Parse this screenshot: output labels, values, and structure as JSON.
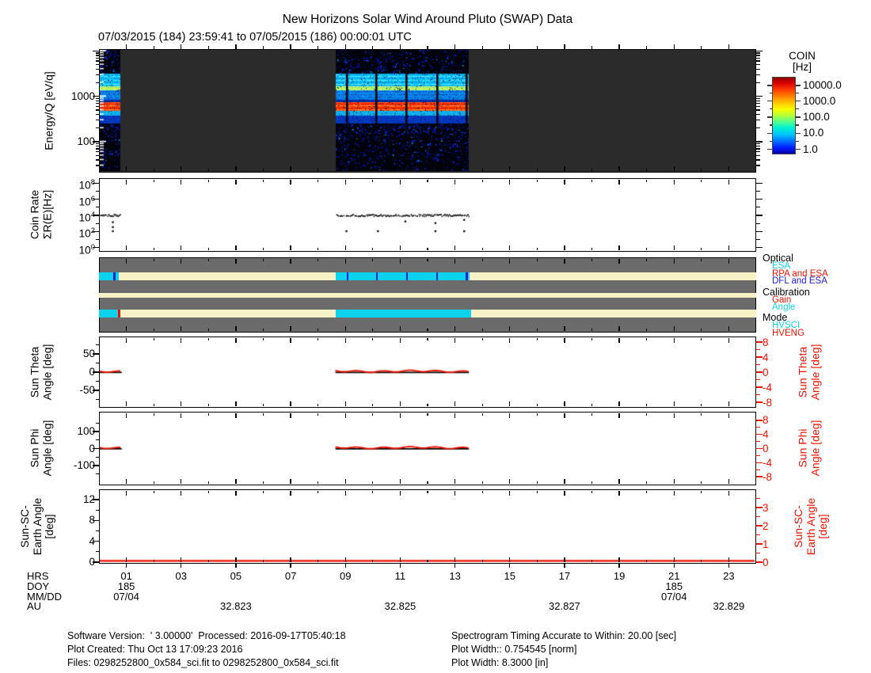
{
  "title": "New Horizons Solar Wind Around Pluto (SWAP) Data",
  "subtitle": "07/03/2015 (184) 23:59:41 to 07/05/2015 (186) 00:00:01 UTC",
  "colors": {
    "cyan": "#0CD2EE",
    "red": "#EE1100",
    "blue": "#2121D6",
    "cream": "#F6F2C6",
    "panel_gray": "#6B6B6B",
    "spec_bg": "#2B2B2B",
    "black": "#000000",
    "white": "#FFFFFF"
  },
  "colorbar": {
    "title_lines": [
      "COIN",
      "[Hz]"
    ],
    "tick_labels": [
      "10000.0",
      "1000.0",
      "100.0",
      "10.0",
      "1.0"
    ]
  },
  "panels": {
    "spectrogram": {
      "ylabel_lines": [
        "Energy/Q [eV/q]"
      ],
      "ytick_labels": [
        "1000",
        "100"
      ]
    },
    "coinrate": {
      "ylabel_lines": [
        "Coin Rate",
        "ΣR(E)[Hz]"
      ],
      "ytick_exponents": [
        "8",
        "6",
        "4",
        "2",
        "0"
      ]
    },
    "theta": {
      "ylabel_lines": [
        "Sun Theta",
        "Angle [deg]"
      ],
      "left_tick_labels": [
        "50",
        "0",
        "-50"
      ],
      "right_label_lines": [
        "Sun Theta",
        "Angle [deg]"
      ],
      "right_tick_labels": [
        "8",
        "4",
        "0",
        "-4",
        "-8"
      ]
    },
    "phi": {
      "ylabel_lines": [
        "Sun Phi",
        "Angle [deg]"
      ],
      "left_tick_labels": [
        "100",
        "0",
        "-100"
      ],
      "right_label_lines": [
        "Sun Phi",
        "Angle [deg]"
      ],
      "right_tick_labels": [
        "8",
        "4",
        "0",
        "-4",
        "-8"
      ]
    },
    "earth": {
      "ylabel_lines": [
        "Sun-SC-",
        "Earth Angle",
        "[deg]"
      ],
      "left_tick_labels": [
        "12",
        "8",
        "4",
        "0"
      ],
      "right_label_lines": [
        "Sun-SC-",
        "Earth Angle",
        "[deg]"
      ],
      "right_tick_labels": [
        "3",
        "2",
        "1",
        "0"
      ]
    }
  },
  "status_legend": [
    {
      "text": "Optical",
      "color_key": "black",
      "indent": 0
    },
    {
      "text": "ESA",
      "color_key": "cyan",
      "indent": 1
    },
    {
      "text": "RPA and ESA",
      "color_key": "red",
      "indent": 1
    },
    {
      "text": "DFL and ESA",
      "color_key": "blue",
      "indent": 1
    },
    {
      "text": "Calibration",
      "color_key": "black",
      "indent": 0
    },
    {
      "text": "Gain",
      "color_key": "red",
      "indent": 1
    },
    {
      "text": "Angle",
      "color_key": "cyan",
      "indent": 1
    },
    {
      "text": "Mode",
      "color_key": "black",
      "indent": 0
    },
    {
      "text": "HVSCI",
      "color_key": "cyan",
      "indent": 1
    },
    {
      "text": "HVENG",
      "color_key": "red",
      "indent": 1
    }
  ],
  "xaxis": {
    "row_labels": [
      "HRS",
      "DOY",
      "MM/DD",
      "AU"
    ],
    "hour_tick_labels": [
      "01",
      "03",
      "05",
      "07",
      "09",
      "11",
      "13",
      "15",
      "17",
      "19",
      "21",
      "23"
    ],
    "hour_tick_values": [
      1,
      3,
      5,
      7,
      9,
      11,
      13,
      15,
      17,
      19,
      21,
      23
    ],
    "doy_labels": [
      {
        "label": "185",
        "hour": 1
      },
      {
        "label": "185",
        "hour": 21
      }
    ],
    "mmdd_labels": [
      {
        "label": "07/04",
        "hour": 1
      },
      {
        "label": "07/04",
        "hour": 21
      }
    ],
    "au_labels": [
      {
        "label": "32.823",
        "hour": 5
      },
      {
        "label": "32.825",
        "hour": 11
      },
      {
        "label": "32.827",
        "hour": 17
      },
      {
        "label": "32.829",
        "hour": 23
      }
    ]
  },
  "footer": {
    "left": [
      "Software Version:  ' 3.00000'  Processed: 2016-09-17T05:40:18",
      "Plot Created: Thu Oct 13 17:09:23 2016",
      "Files: 0298252800_0x584_sci.fit to 0298252800_0x584_sci.fit"
    ],
    "right": [
      "Spectrogram Timing Accurate to Within: 20.00 [sec]",
      "Plot Width:: 0.754545 [norm]",
      "Plot Width: 8.3000 [in]"
    ]
  },
  "chart_data": [
    {
      "type": "heatmap",
      "name": "energy_spectrogram",
      "ylabel": "Energy/Q [eV/q]",
      "y_scale": "log",
      "y_range_eVq": [
        21,
        11000
      ],
      "y_tick_values": [
        100,
        1000
      ],
      "colorbar_title": "COIN [Hz]",
      "colorbar_scale": "log",
      "colorbar_tick_values_hz": [
        10000.0,
        1000.0,
        100.0,
        10.0,
        1.0
      ],
      "x_range_hours_doy185": [
        0,
        24
      ],
      "data_intervals_hours": [
        [
          0.0,
          0.8
        ],
        [
          8.65,
          13.53
        ]
      ],
      "no_data_color": "#2B2B2B",
      "bands": [
        {
          "energy_eVq": [
            1750,
            3100
          ],
          "coin_hz_approx": 100,
          "appearance": "cyan mottled band"
        },
        {
          "energy_eVq": [
            1440,
            1750
          ],
          "coin_hz_approx": 700,
          "appearance": "green-yellow line (alpha particles)"
        },
        {
          "energy_eVq": [
            770,
            1440
          ],
          "coin_hz_approx": 30,
          "appearance": "blue mottled band"
        },
        {
          "energy_eVq": [
            480,
            770
          ],
          "coin_hz_approx": 10000,
          "appearance": "intense red-orange band (solar wind beam)"
        },
        {
          "energy_eVq": [
            375,
            480
          ],
          "coin_hz_approx": 100,
          "appearance": "cyan band"
        },
        {
          "energy_eVq": [
            21,
            375
          ],
          "coin_hz_approx": 3,
          "appearance": "sparse blue speckle on black"
        }
      ],
      "gap_hours": [
        9.08,
        10.15,
        11.25,
        12.35,
        13.42
      ]
    },
    {
      "type": "scatter",
      "name": "coin_rate",
      "ylabel": "Coin Rate ΣR(E)[Hz]",
      "y_scale": "log",
      "y_tick_exponents": [
        8,
        6,
        4,
        2,
        0
      ],
      "line_value_hz": 10000,
      "line_intervals_hours": [
        [
          0.0,
          0.8
        ],
        [
          8.65,
          13.53
        ]
      ],
      "outlier_points": [
        {
          "hour": 0.52,
          "hz": 1300
        },
        {
          "hour": 0.52,
          "hz": 320
        },
        {
          "hour": 0.52,
          "hz": 100
        },
        {
          "hour": 9.05,
          "hz": 100
        },
        {
          "hour": 10.2,
          "hz": 100
        },
        {
          "hour": 11.2,
          "hz": 1600
        },
        {
          "hour": 12.3,
          "hz": 1000
        },
        {
          "hour": 12.3,
          "hz": 100
        },
        {
          "hour": 13.35,
          "hz": 2500
        },
        {
          "hour": 13.35,
          "hz": 100
        }
      ]
    },
    {
      "type": "status-bars",
      "name": "instrument_state",
      "rows": [
        {
          "name": "Optical",
          "segments": [
            {
              "state": "ESA",
              "hours": [
                0.0,
                0.52
              ]
            },
            {
              "state": "DFL and ESA",
              "hours": [
                0.52,
                0.6
              ]
            },
            {
              "state": "ESA",
              "hours": [
                0.6,
                0.73
              ]
            },
            {
              "state": "idle",
              "hours": [
                0.73,
                8.65
              ]
            },
            {
              "state": "ESA",
              "hours": [
                8.65,
                13.53
              ]
            },
            {
              "state": "idle",
              "hours": [
                13.53,
                24.0
              ]
            }
          ],
          "dfl_tick_hours": [
            9.08,
            10.15,
            11.25,
            12.35,
            13.42
          ]
        },
        {
          "name": "Calibration",
          "segments": [
            {
              "state": "idle",
              "hours": [
                0.0,
                24.0
              ]
            }
          ],
          "dfl_tick_hours": []
        },
        {
          "name": "Mode",
          "segments": [
            {
              "state": "HVSCI",
              "hours": [
                0.0,
                0.69
              ]
            },
            {
              "state": "HVENG",
              "hours": [
                0.69,
                0.77
              ]
            },
            {
              "state": "idle",
              "hours": [
                0.77,
                8.65
              ]
            },
            {
              "state": "HVSCI",
              "hours": [
                8.65,
                13.59
              ]
            },
            {
              "state": "idle",
              "hours": [
                13.59,
                24.0
              ]
            }
          ],
          "dfl_tick_hours": []
        }
      ]
    },
    {
      "type": "line",
      "name": "sun_theta_angle",
      "ylabel": "Sun Theta Angle [deg]",
      "left_tick_values": [
        50,
        0,
        -50
      ],
      "right_tick_values": [
        8,
        4,
        0,
        -4,
        -8
      ],
      "value_deg": 0,
      "intervals_hours": [
        [
          0.0,
          0.85
        ],
        [
          8.65,
          13.53
        ]
      ]
    },
    {
      "type": "line",
      "name": "sun_phi_angle",
      "ylabel": "Sun Phi Angle [deg]",
      "left_tick_values": [
        100,
        0,
        -100
      ],
      "right_tick_values": [
        8,
        4,
        0,
        -4,
        -8
      ],
      "value_deg": 0,
      "intervals_hours": [
        [
          0.0,
          0.85
        ],
        [
          8.65,
          13.53
        ]
      ]
    },
    {
      "type": "line",
      "name": "sun_sc_earth_angle",
      "ylabel": "Sun-SC-Earth Angle [deg]",
      "left_tick_values": [
        12,
        8,
        4,
        0
      ],
      "right_tick_values": [
        3,
        2,
        1,
        0
      ],
      "value_deg": 0.1,
      "intervals_hours": [
        [
          0.0,
          24.0
        ]
      ]
    }
  ]
}
